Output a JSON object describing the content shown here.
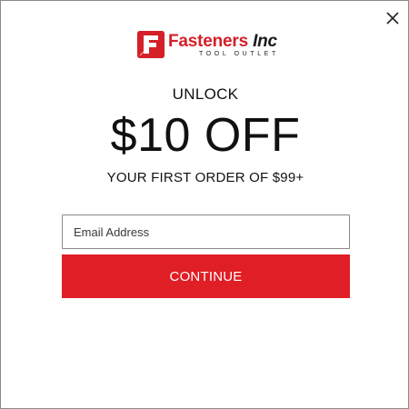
{
  "popup": {
    "brand": {
      "name": "Fasteners",
      "name_suffix": "Inc",
      "tagline": "TOOL OUTLET",
      "logo_icon": "logo-f-icon",
      "brand_color": "#d42027"
    },
    "close_icon": "close-icon",
    "headline_small": "UNLOCK",
    "headline_big": "$10 OFF",
    "headline_sub": "YOUR FIRST ORDER OF $99+",
    "email": {
      "placeholder": "Email Address",
      "value": ""
    },
    "continue_label": "CONTINUE",
    "accent_color": "#e01e26"
  }
}
